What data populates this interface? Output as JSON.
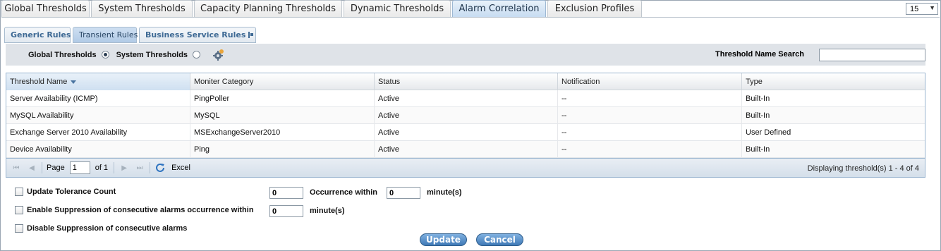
{
  "top_tabs": [
    "Global Thresholds",
    "System Thresholds",
    "Capacity Planning Thresholds",
    "Dynamic Thresholds",
    "Alarm Correlation",
    "Exclusion Profiles"
  ],
  "top_tab_active": "Alarm Correlation",
  "page_size_select": "15",
  "sub_tabs": [
    "Generic Rules",
    "Transient Rules",
    "Business Service Rules"
  ],
  "sub_tab_active": "Transient Rules",
  "filter": {
    "global_label": "Global Thresholds",
    "system_label": "System Thresholds",
    "selected": "Global Thresholds",
    "search_label": "Threshold Name Search",
    "search_value": ""
  },
  "grid": {
    "columns": [
      "Threshold Name",
      "Moniter Category",
      "Status",
      "Notification",
      "Type"
    ],
    "sorted_column": "Threshold Name",
    "rows": [
      [
        "Server Availability (ICMP)",
        "PingPoller",
        "Active",
        "--",
        "Built-In"
      ],
      [
        "MySQL Availability",
        "MySQL",
        "Active",
        "--",
        "Built-In"
      ],
      [
        "Exchange Server 2010 Availability",
        "MSExchangeServer2010",
        "Active",
        "--",
        "User Defined"
      ],
      [
        "Device Availability",
        "Ping",
        "Active",
        "--",
        "Built-In"
      ]
    ]
  },
  "pager": {
    "page_label": "Page",
    "page_value": "1",
    "of_label": "of 1",
    "excel_label": "Excel",
    "info": "Displaying threshold(s) 1 - 4 of 4"
  },
  "options": {
    "update_tolerance_label": "Update Tolerance Count",
    "update_tolerance_value": "0",
    "occurrence_within_label": "Occurrence within",
    "occurrence_within_value": "0",
    "minutes_label": "minute(s)",
    "enable_suppression_label": "Enable Suppression of consecutive alarms occurrence within",
    "enable_suppression_value": "0",
    "disable_suppression_label": "Disable Suppression of consecutive alarms"
  },
  "buttons": {
    "update": "Update",
    "cancel": "Cancel"
  }
}
